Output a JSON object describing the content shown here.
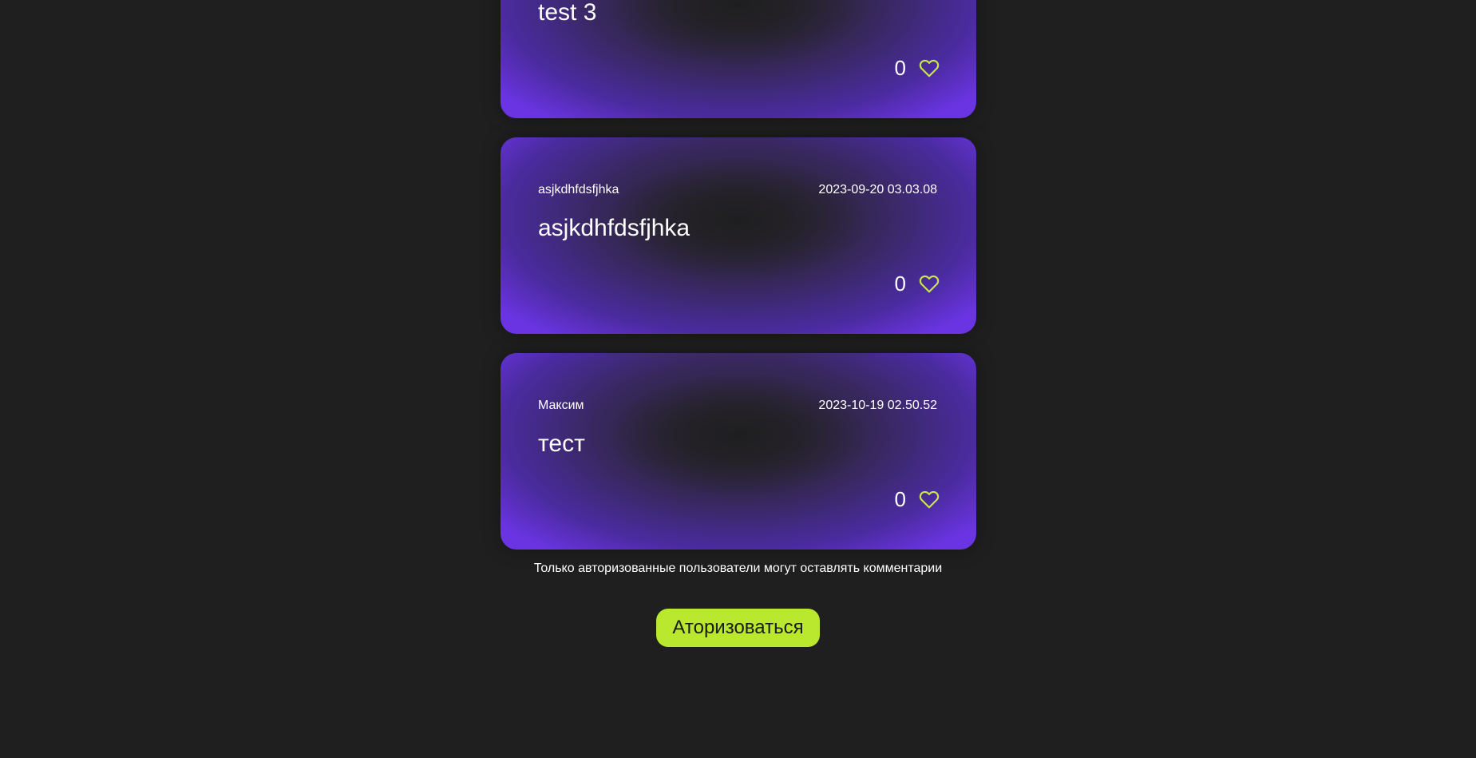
{
  "posts": [
    {
      "title": "test 3",
      "likes": "0"
    },
    {
      "author": "asjkdhfdsfjhka",
      "date": "2023-09-20 03.03.08",
      "title": "asjkdhfdsfjhka",
      "likes": "0"
    },
    {
      "author": "Максим",
      "date": "2023-10-19 02.50.52",
      "title": "тест",
      "likes": "0"
    }
  ],
  "auth": {
    "notice": "Только авторизованные пользователи могут оставлять комментарии",
    "button_label": "Аторизоваться"
  },
  "colors": {
    "background": "#1f1f1f",
    "card_accent": "#6a34e2",
    "like_icon": "#c9e64a",
    "button": "#b9e82f"
  },
  "icons": {
    "like": "heart-icon"
  }
}
